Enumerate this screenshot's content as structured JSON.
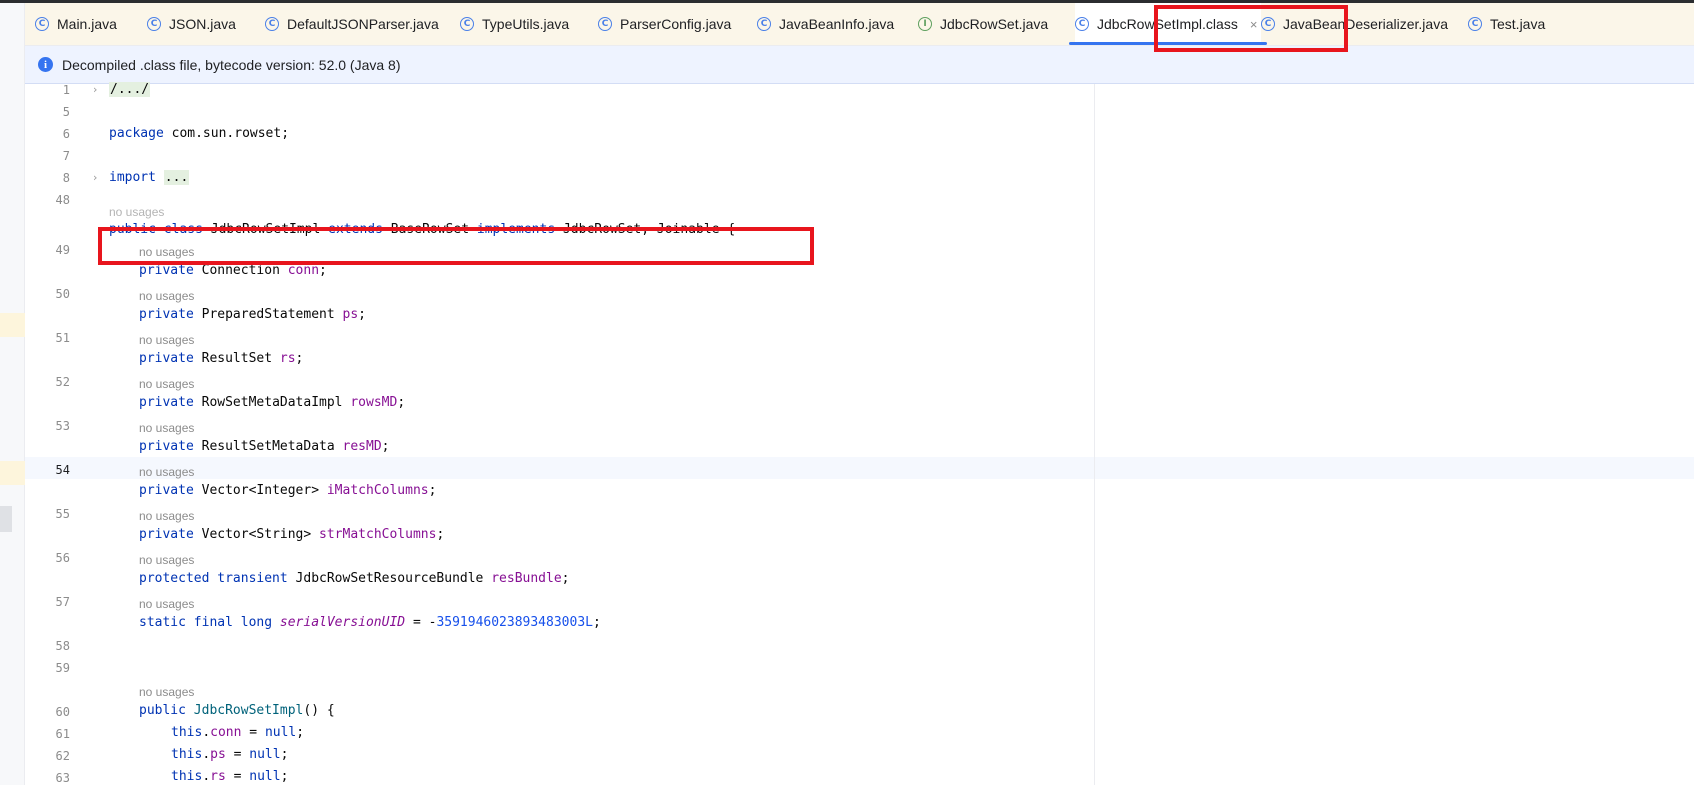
{
  "tabs": [
    {
      "label": "Main.java",
      "icon": "class-icon"
    },
    {
      "label": "JSON.java",
      "icon": "class-icon"
    },
    {
      "label": "DefaultJSONParser.java",
      "icon": "class-icon"
    },
    {
      "label": "TypeUtils.java",
      "icon": "class-icon"
    },
    {
      "label": "ParserConfig.java",
      "icon": "class-icon"
    },
    {
      "label": "JavaBeanInfo.java",
      "icon": "class-icon"
    },
    {
      "label": "JdbcRowSet.java",
      "icon": "interface-icon"
    },
    {
      "label": "JdbcRowSetImpl.class",
      "icon": "class-icon",
      "active": true
    },
    {
      "label": "JavaBeanDeserializer.java",
      "icon": "class-icon"
    },
    {
      "label": "Test.java",
      "icon": "class-icon"
    }
  ],
  "tab_icon_glyphs": {
    "class": "C",
    "interface": "I"
  },
  "tab_close_glyph": "×",
  "info_icon_glyph": "i",
  "infobar": {
    "text": "Decompiled .class file, bytecode version: 52.0 (Java 8)"
  },
  "hint_text": "no usages",
  "gutter": [
    "1",
    "5",
    "6",
    "7",
    "8",
    "48",
    "49",
    "50",
    "51",
    "52",
    "53",
    "54",
    "55",
    "56",
    "57",
    "58",
    "59",
    "60",
    "61",
    "62",
    "63"
  ],
  "fold_glyph": "›",
  "code": {
    "l1": "/.../",
    "l6_kw": "package",
    "l6_rest": " com.sun.rowset;",
    "l8_kw": "import",
    "l8_fold": "...",
    "l49_kw1": "public class",
    "l49_t1": " JdbcRowSetImpl ",
    "l49_kw2": "extends",
    "l49_t2": " BaseRowSet ",
    "l49_kw3": "implements",
    "l49_t3": " JdbcRowSet, Joinable {",
    "kw_private": "private",
    "l50_type": " Connection ",
    "l50_field": "conn",
    "l51_type": " PreparedStatement ",
    "l51_field": "ps",
    "l52_type": " ResultSet ",
    "l52_field": "rs",
    "l53_type": " RowSetMetaDataImpl ",
    "l53_field": "rowsMD",
    "l54_type": " ResultSetMetaData ",
    "l54_field": "resMD",
    "l55_type": " Vector<Integer> ",
    "l55_field": "iMatchColumns",
    "l56_type": " Vector<String> ",
    "l56_field": "strMatchColumns",
    "l57_kw": "protected transient",
    "l57_type": " JdbcRowSetResourceBundle ",
    "l57_field": "resBundle",
    "l58_kw": "static final long",
    "l58_field": "serialVersionUID",
    "l58_eq": " = -",
    "l58_num": "3591946023893483003L",
    "l60_kw": "public",
    "l60_rest": "() {",
    "l60_name": " JdbcRowSetImpl",
    "kw_this": "this",
    "l61_field": "conn",
    "l62_field": "ps",
    "l63_field": "rs",
    "assign_null_kw": "null",
    "semi": ";",
    "dot": ".",
    "eq": " = "
  },
  "highlight_color": "#e8151d"
}
